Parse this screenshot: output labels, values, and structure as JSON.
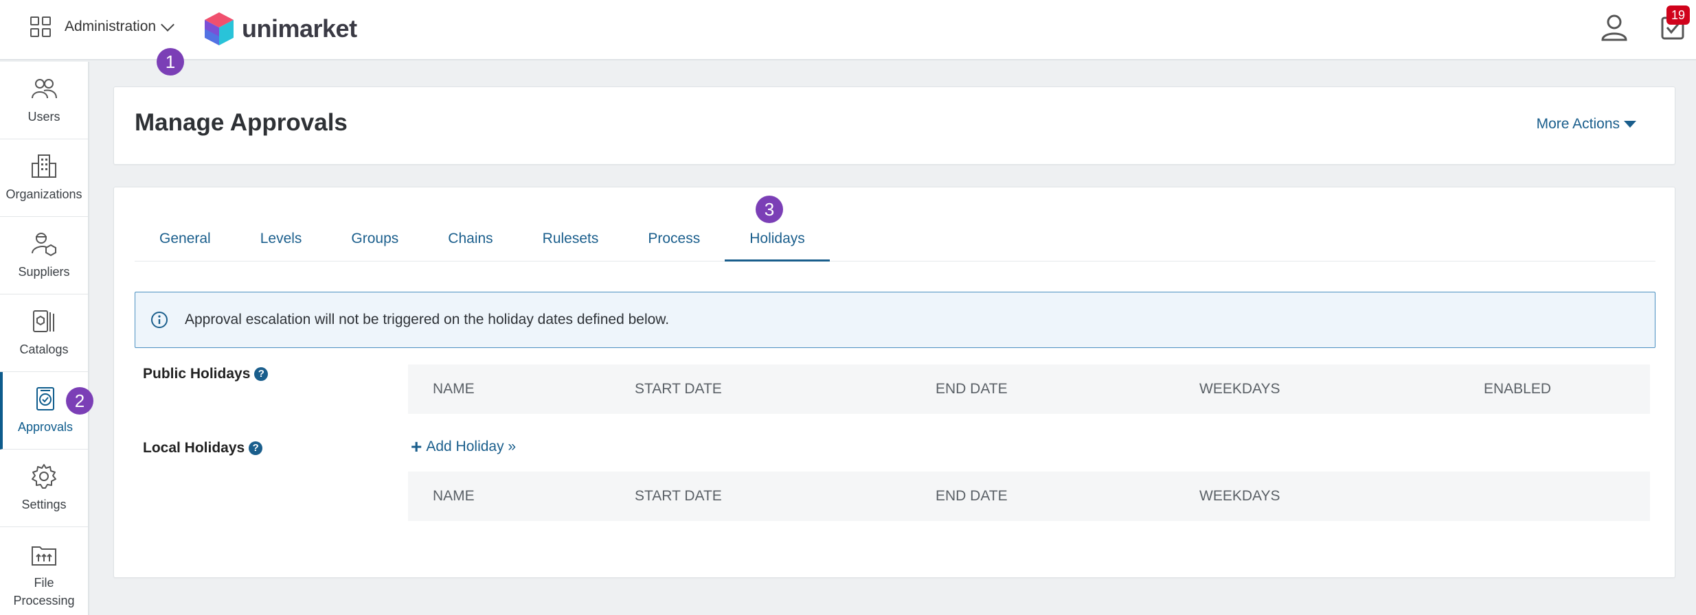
{
  "header": {
    "app_name": "Administration",
    "logo_text": "unimarket",
    "notification_count": "19"
  },
  "markers": {
    "m1": "1",
    "m2": "2",
    "m3": "3"
  },
  "sidebar": {
    "items": [
      {
        "label": "Users"
      },
      {
        "label": "Organizations"
      },
      {
        "label": "Suppliers"
      },
      {
        "label": "Catalogs"
      },
      {
        "label": "Approvals"
      },
      {
        "label": "Settings"
      },
      {
        "label": "File Processing"
      }
    ]
  },
  "page": {
    "title": "Manage Approvals",
    "more_actions": "More Actions"
  },
  "tabs": [
    {
      "label": "General"
    },
    {
      "label": "Levels"
    },
    {
      "label": "Groups"
    },
    {
      "label": "Chains"
    },
    {
      "label": "Rulesets"
    },
    {
      "label": "Process"
    },
    {
      "label": "Holidays"
    }
  ],
  "info": {
    "text": "Approval escalation will not be triggered on the holiday dates defined below."
  },
  "public_holidays": {
    "label": "Public Holidays",
    "columns": [
      "NAME",
      "START DATE",
      "END DATE",
      "WEEKDAYS",
      "ENABLED"
    ]
  },
  "local_holidays": {
    "label": "Local Holidays",
    "add_label": "Add Holiday »",
    "columns": [
      "NAME",
      "START DATE",
      "END DATE",
      "WEEKDAYS"
    ]
  },
  "colors": {
    "accent": "#1a5e8c",
    "marker": "#7b3fb6",
    "badge": "#d0021b"
  }
}
